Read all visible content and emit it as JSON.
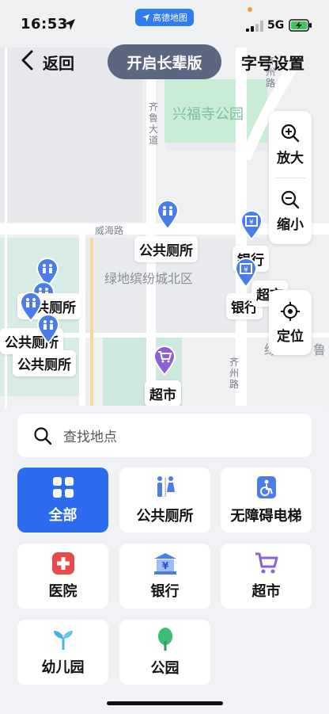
{
  "status_bar": {
    "time": "16:53",
    "network": "5G",
    "app_badge": "高德地图"
  },
  "nav": {
    "back_label": "返回",
    "elder_mode_label": "开启长辈版",
    "font_setting_label": "字号设置"
  },
  "map": {
    "controls": {
      "zoom_in_label": "放大",
      "zoom_out_label": "缩小",
      "locate_label": "定位"
    },
    "place_labels": [
      "兴福寺公园",
      "绿地缤纷城北区",
      "绿",
      "鲁",
      "齐州路",
      "齐鲁大道",
      "威海路",
      "齐州路"
    ],
    "poi_labels": {
      "toilet_1": "公共厕所",
      "toilet_2": "公共厕所",
      "toilet_3": "公共厕所",
      "toilet_4": "公共厕所",
      "bank_1": "银行",
      "bank_2": "银行",
      "market_1": "超市",
      "market_2": "超市"
    }
  },
  "sheet": {
    "search_placeholder": "查找地点",
    "categories": [
      {
        "label": "全部",
        "icon": "grid-icon"
      },
      {
        "label": "公共厕所",
        "icon": "toilet-icon"
      },
      {
        "label": "无障碍电梯",
        "icon": "accessible-elevator-icon"
      },
      {
        "label": "医院",
        "icon": "hospital-cross-icon"
      },
      {
        "label": "银行",
        "icon": "bank-icon"
      },
      {
        "label": "超市",
        "icon": "cart-icon"
      },
      {
        "label": "幼儿园",
        "icon": "sprout-icon"
      },
      {
        "label": "公园",
        "icon": "tree-icon"
      }
    ]
  },
  "colors": {
    "accent": "#2c6bee",
    "elder_btn": "#5b6781",
    "park": "#cdeedd",
    "poi_blue": "#4a7de8",
    "poi_purple": "#8b5fd6"
  }
}
